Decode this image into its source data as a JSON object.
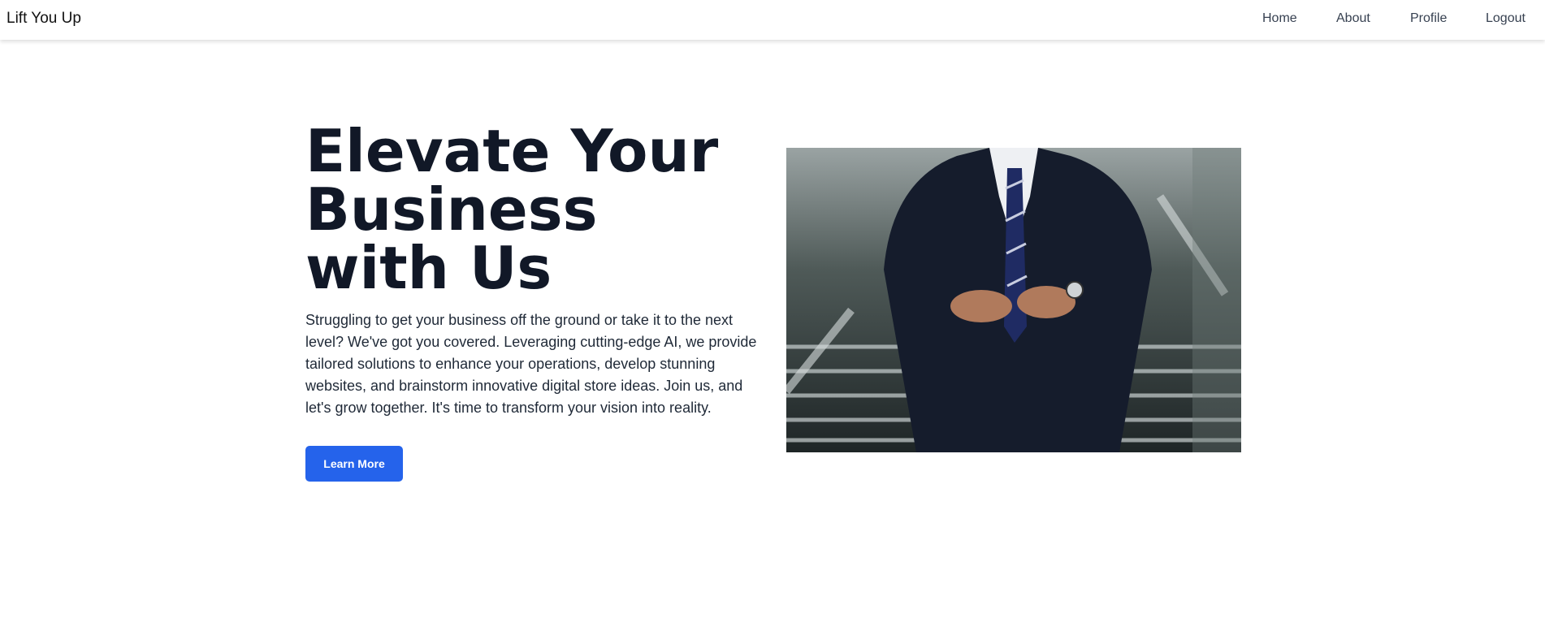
{
  "nav": {
    "brand": "Lift You Up",
    "links": [
      "Home",
      "About",
      "Profile",
      "Logout"
    ]
  },
  "hero": {
    "title": "Elevate Your Business with Us",
    "description": "Struggling to get your business off the ground or take it to the next level? We've got you covered. Leveraging cutting-edge AI, we provide tailored solutions to enhance your operations, develop stunning websites, and brainstorm innovative digital store ideas. Join us, and let's grow together. It's time to transform your vision into reality.",
    "button": "Learn More",
    "image": "businessman-in-suit-on-stairs-photo"
  },
  "colors": {
    "accent": "#2563eb",
    "heading": "#111827"
  }
}
